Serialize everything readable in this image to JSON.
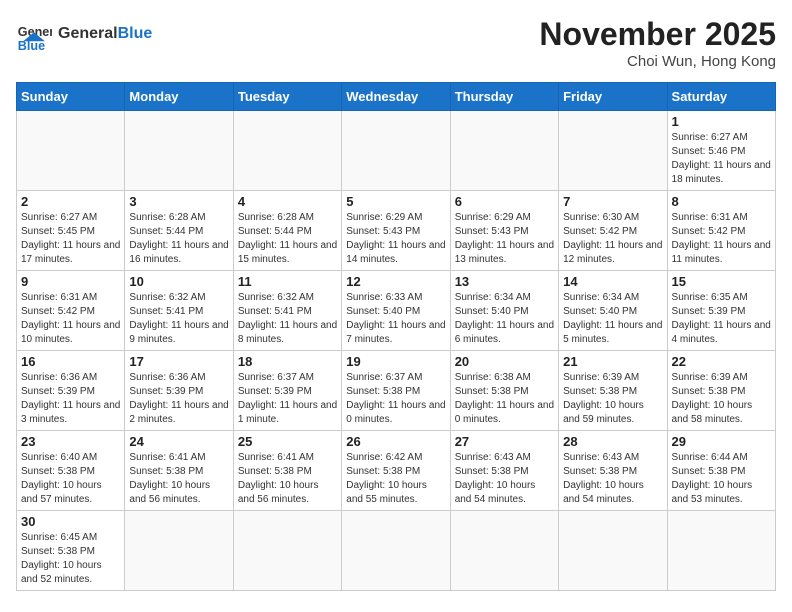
{
  "header": {
    "logo_general": "General",
    "logo_blue": "Blue",
    "month_year": "November 2025",
    "location": "Choi Wun, Hong Kong"
  },
  "days_of_week": [
    "Sunday",
    "Monday",
    "Tuesday",
    "Wednesday",
    "Thursday",
    "Friday",
    "Saturday"
  ],
  "weeks": [
    [
      null,
      null,
      null,
      null,
      null,
      null,
      {
        "day": "1",
        "sunrise": "6:27 AM",
        "sunset": "5:46 PM",
        "daylight": "11 hours and 18 minutes."
      }
    ],
    [
      {
        "day": "2",
        "sunrise": "6:27 AM",
        "sunset": "5:45 PM",
        "daylight": "11 hours and 17 minutes."
      },
      {
        "day": "3",
        "sunrise": "6:28 AM",
        "sunset": "5:44 PM",
        "daylight": "11 hours and 16 minutes."
      },
      {
        "day": "4",
        "sunrise": "6:28 AM",
        "sunset": "5:44 PM",
        "daylight": "11 hours and 15 minutes."
      },
      {
        "day": "5",
        "sunrise": "6:29 AM",
        "sunset": "5:43 PM",
        "daylight": "11 hours and 14 minutes."
      },
      {
        "day": "6",
        "sunrise": "6:29 AM",
        "sunset": "5:43 PM",
        "daylight": "11 hours and 13 minutes."
      },
      {
        "day": "7",
        "sunrise": "6:30 AM",
        "sunset": "5:42 PM",
        "daylight": "11 hours and 12 minutes."
      },
      {
        "day": "8",
        "sunrise": "6:31 AM",
        "sunset": "5:42 PM",
        "daylight": "11 hours and 11 minutes."
      }
    ],
    [
      {
        "day": "9",
        "sunrise": "6:31 AM",
        "sunset": "5:42 PM",
        "daylight": "11 hours and 10 minutes."
      },
      {
        "day": "10",
        "sunrise": "6:32 AM",
        "sunset": "5:41 PM",
        "daylight": "11 hours and 9 minutes."
      },
      {
        "day": "11",
        "sunrise": "6:32 AM",
        "sunset": "5:41 PM",
        "daylight": "11 hours and 8 minutes."
      },
      {
        "day": "12",
        "sunrise": "6:33 AM",
        "sunset": "5:40 PM",
        "daylight": "11 hours and 7 minutes."
      },
      {
        "day": "13",
        "sunrise": "6:34 AM",
        "sunset": "5:40 PM",
        "daylight": "11 hours and 6 minutes."
      },
      {
        "day": "14",
        "sunrise": "6:34 AM",
        "sunset": "5:40 PM",
        "daylight": "11 hours and 5 minutes."
      },
      {
        "day": "15",
        "sunrise": "6:35 AM",
        "sunset": "5:39 PM",
        "daylight": "11 hours and 4 minutes."
      }
    ],
    [
      {
        "day": "16",
        "sunrise": "6:36 AM",
        "sunset": "5:39 PM",
        "daylight": "11 hours and 3 minutes."
      },
      {
        "day": "17",
        "sunrise": "6:36 AM",
        "sunset": "5:39 PM",
        "daylight": "11 hours and 2 minutes."
      },
      {
        "day": "18",
        "sunrise": "6:37 AM",
        "sunset": "5:39 PM",
        "daylight": "11 hours and 1 minute."
      },
      {
        "day": "19",
        "sunrise": "6:37 AM",
        "sunset": "5:38 PM",
        "daylight": "11 hours and 0 minutes."
      },
      {
        "day": "20",
        "sunrise": "6:38 AM",
        "sunset": "5:38 PM",
        "daylight": "11 hours and 0 minutes."
      },
      {
        "day": "21",
        "sunrise": "6:39 AM",
        "sunset": "5:38 PM",
        "daylight": "10 hours and 59 minutes."
      },
      {
        "day": "22",
        "sunrise": "6:39 AM",
        "sunset": "5:38 PM",
        "daylight": "10 hours and 58 minutes."
      }
    ],
    [
      {
        "day": "23",
        "sunrise": "6:40 AM",
        "sunset": "5:38 PM",
        "daylight": "10 hours and 57 minutes."
      },
      {
        "day": "24",
        "sunrise": "6:41 AM",
        "sunset": "5:38 PM",
        "daylight": "10 hours and 56 minutes."
      },
      {
        "day": "25",
        "sunrise": "6:41 AM",
        "sunset": "5:38 PM",
        "daylight": "10 hours and 56 minutes."
      },
      {
        "day": "26",
        "sunrise": "6:42 AM",
        "sunset": "5:38 PM",
        "daylight": "10 hours and 55 minutes."
      },
      {
        "day": "27",
        "sunrise": "6:43 AM",
        "sunset": "5:38 PM",
        "daylight": "10 hours and 54 minutes."
      },
      {
        "day": "28",
        "sunrise": "6:43 AM",
        "sunset": "5:38 PM",
        "daylight": "10 hours and 54 minutes."
      },
      {
        "day": "29",
        "sunrise": "6:44 AM",
        "sunset": "5:38 PM",
        "daylight": "10 hours and 53 minutes."
      }
    ],
    [
      {
        "day": "30",
        "sunrise": "6:45 AM",
        "sunset": "5:38 PM",
        "daylight": "10 hours and 52 minutes."
      },
      null,
      null,
      null,
      null,
      null,
      null
    ]
  ]
}
